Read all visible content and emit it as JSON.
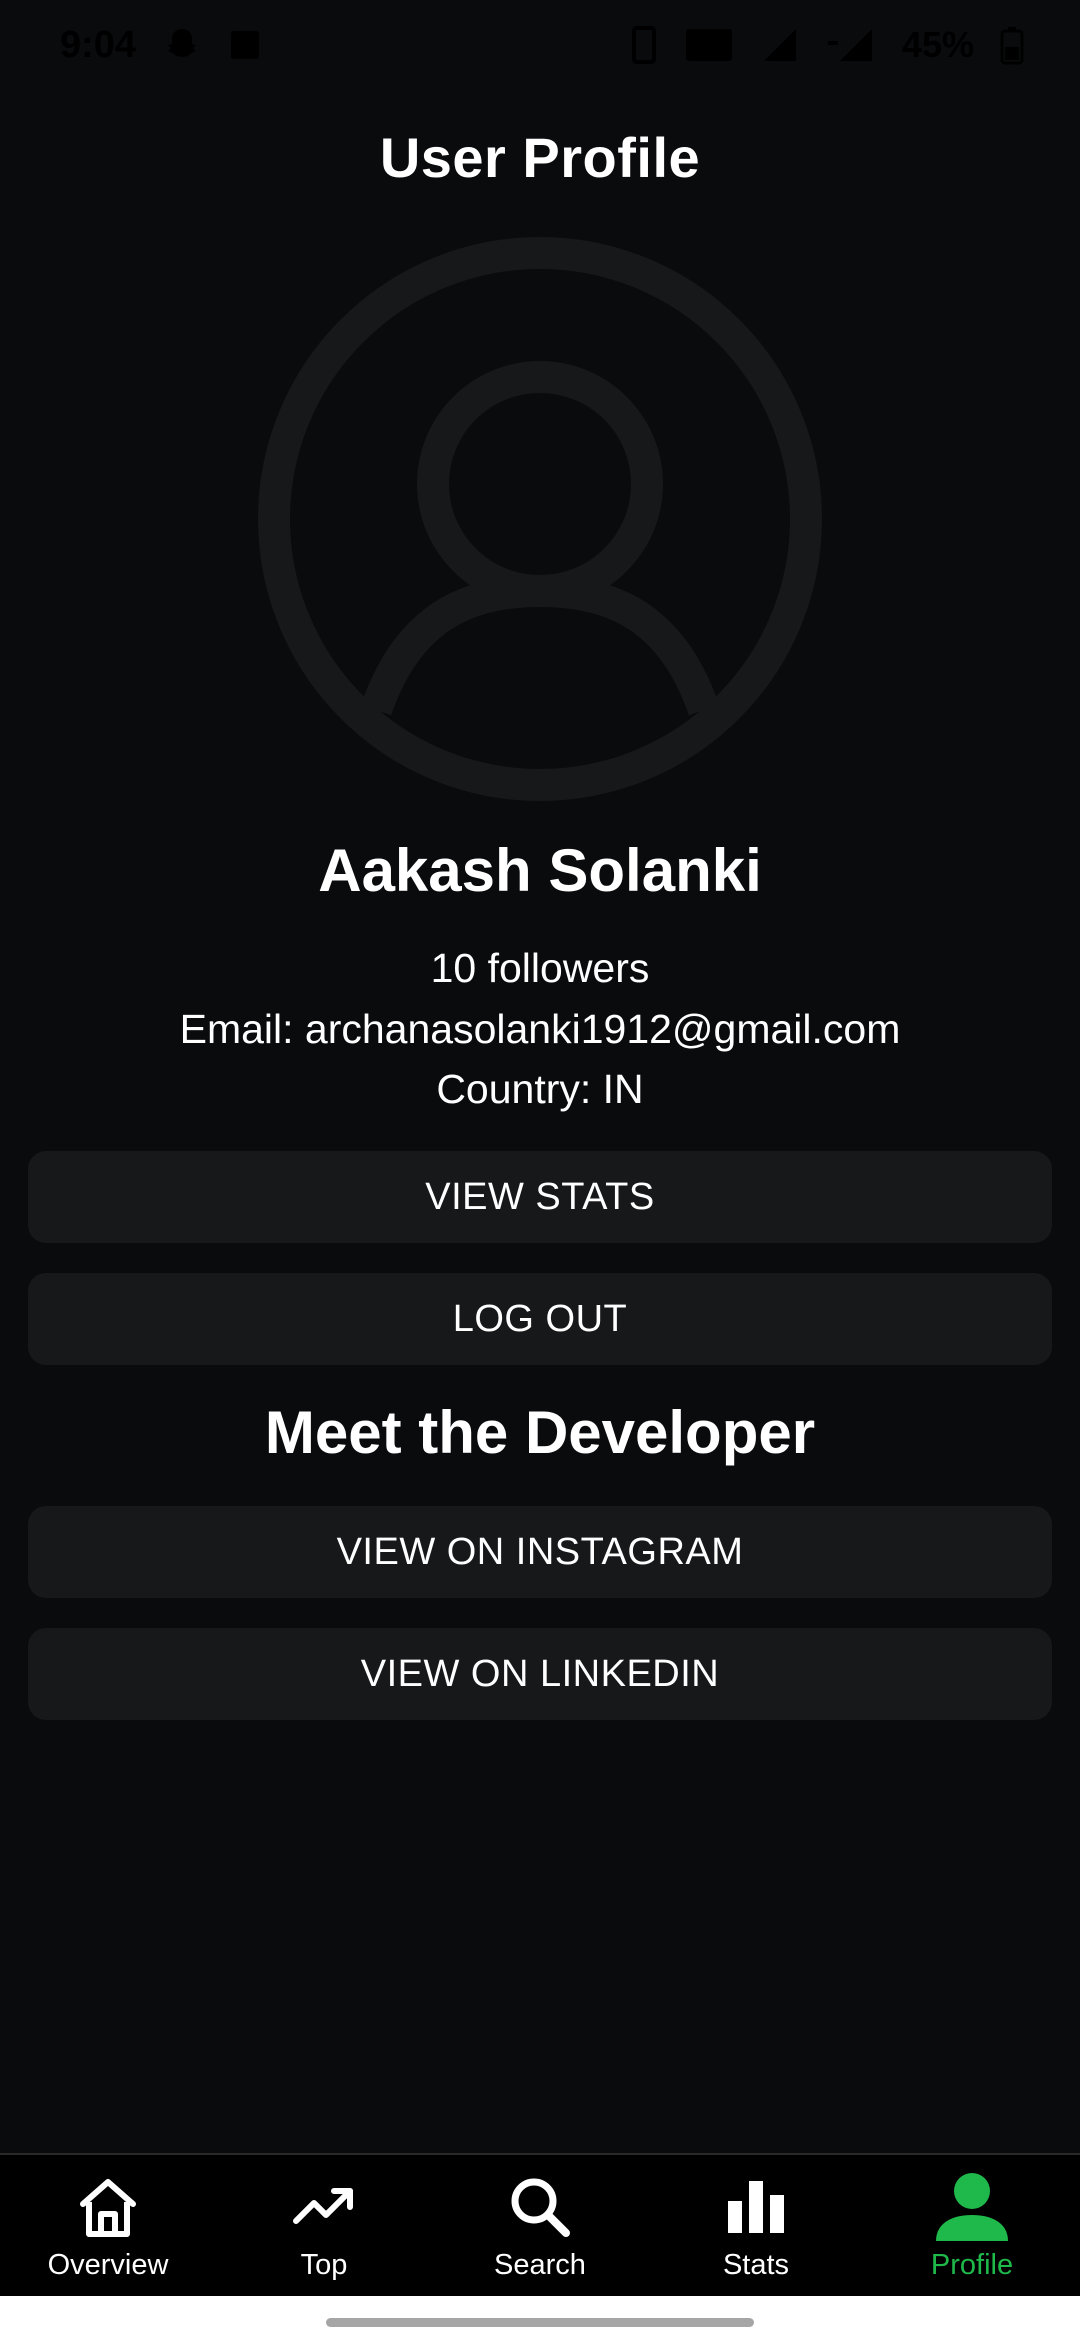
{
  "status_bar": {
    "time": "9:04",
    "battery": "45%",
    "icons": [
      "snapchat-icon",
      "gallery-icon",
      "vibrate-icon",
      "volte-icon",
      "signal-icon",
      "signal-4g-icon",
      "battery-icon"
    ]
  },
  "header": {
    "title": "User Profile"
  },
  "profile": {
    "avatar_icon": "account-circle-icon",
    "name": "Aakash Solanki",
    "followers": "10 followers",
    "email": "Email: archanasolanki1912@gmail.com",
    "country": "Country: IN"
  },
  "actions": {
    "view_stats": "VIEW STATS",
    "log_out": "LOG OUT"
  },
  "developer": {
    "title": "Meet the Developer",
    "instagram": "VIEW ON INSTAGRAM",
    "linkedin": "VIEW ON LINKEDIN"
  },
  "bottom_nav": {
    "items": [
      {
        "label": "Overview",
        "icon": "home-icon",
        "active": false
      },
      {
        "label": "Top",
        "icon": "trending-up-icon",
        "active": false
      },
      {
        "label": "Search",
        "icon": "search-icon",
        "active": false
      },
      {
        "label": "Stats",
        "icon": "bar-chart-icon",
        "active": false
      },
      {
        "label": "Profile",
        "icon": "person-icon",
        "active": true
      }
    ]
  },
  "colors": {
    "background": "#0a0b0d",
    "button": "#17181a",
    "accent": "#1fb84a",
    "avatar": "#17181a"
  }
}
